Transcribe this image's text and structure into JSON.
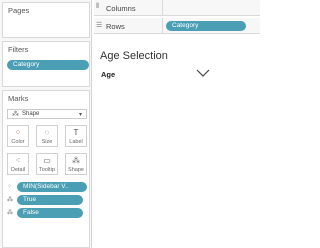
{
  "sidebar": {
    "pages": {
      "title": "Pages"
    },
    "filters": {
      "title": "Filters",
      "pills": [
        "Category"
      ]
    },
    "marks": {
      "title": "Marks",
      "mark_type": "Shape",
      "buttons": [
        {
          "label": "Color",
          "icon": "color-dots-icon"
        },
        {
          "label": "Size",
          "icon": "size-icon"
        },
        {
          "label": "Label",
          "icon": "label-icon"
        },
        {
          "label": "Detail",
          "icon": "detail-icon"
        },
        {
          "label": "Tooltip",
          "icon": "tooltip-icon"
        },
        {
          "label": "Shape",
          "icon": "shape-icon"
        }
      ],
      "encodings": [
        {
          "icon": "detail-icon",
          "label": "MIN(Sidebar V.."
        },
        {
          "icon": "shape-icon",
          "label": "True"
        },
        {
          "icon": "shape-icon",
          "label": "False"
        }
      ]
    }
  },
  "shelves": {
    "columns": {
      "label": "Columns",
      "icon": "columns-icon"
    },
    "rows": {
      "label": "Rows",
      "icon": "rows-icon",
      "pill": "Category"
    }
  },
  "view": {
    "title": "Age Selection",
    "header": "Age"
  },
  "colors": {
    "pill": "#4a9fb5"
  }
}
